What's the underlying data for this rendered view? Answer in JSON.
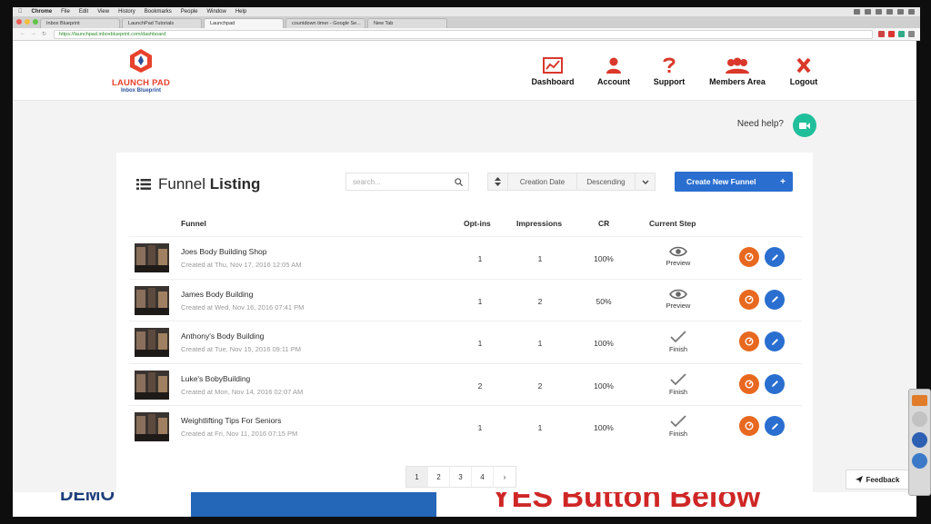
{
  "os_menu": {
    "items": [
      "Chrome",
      "File",
      "Edit",
      "View",
      "History",
      "Bookmarks",
      "People",
      "Window",
      "Help"
    ]
  },
  "browser": {
    "tabs": [
      {
        "label": "Inbox Blueprint",
        "active": false
      },
      {
        "label": "LaunchPad Tutorials",
        "active": false
      },
      {
        "label": "Launchpad",
        "active": true
      },
      {
        "label": "countdown timer - Google Se...",
        "active": false
      },
      {
        "label": "New Tab",
        "active": false
      }
    ],
    "url": "https://launchpad.inboxblueprint.com/dashboard"
  },
  "header": {
    "logo_line1": "LAUNCH PAD",
    "logo_line2": "Inbox Blueprint",
    "nav": [
      {
        "label": "Dashboard",
        "icon": "chart-icon"
      },
      {
        "label": "Account",
        "icon": "user-icon"
      },
      {
        "label": "Support",
        "icon": "question-icon"
      },
      {
        "label": "Members Area",
        "icon": "group-icon"
      },
      {
        "label": "Logout",
        "icon": "close-icon"
      }
    ]
  },
  "help": {
    "label": "Need help?"
  },
  "listing": {
    "title_light": "Funnel",
    "title_bold": "Listing",
    "search_placeholder": "search...",
    "sort_field": "Creation Date",
    "sort_order": "Descending",
    "create_label": "Create New Funnel",
    "columns": {
      "funnel": "Funnel",
      "optins": "Opt-ins",
      "impressions": "Impressions",
      "cr": "CR",
      "step": "Current Step"
    },
    "rows": [
      {
        "name": "Joes Body Building Shop",
        "created": "Created at Thu, Nov 17, 2016 12:05 AM",
        "optins": "1",
        "impressions": "1",
        "cr": "100%",
        "step": "Preview",
        "step_icon": "eye-icon"
      },
      {
        "name": "James Body Building",
        "created": "Created at Wed, Nov 16, 2016 07:41 PM",
        "optins": "1",
        "impressions": "2",
        "cr": "50%",
        "step": "Preview",
        "step_icon": "eye-icon"
      },
      {
        "name": "Anthony's Body Building",
        "created": "Created at Tue, Nov 15, 2016 09:11 PM",
        "optins": "1",
        "impressions": "1",
        "cr": "100%",
        "step": "Finish",
        "step_icon": "check-icon"
      },
      {
        "name": "Luke's BobyBuilding",
        "created": "Created at Mon, Nov 14, 2016 02:07 AM",
        "optins": "2",
        "impressions": "2",
        "cr": "100%",
        "step": "Finish",
        "step_icon": "check-icon"
      },
      {
        "name": "Weightlifting Tips For Seniors",
        "created": "Created at Fri, Nov 11, 2016 07:15 PM",
        "optins": "1",
        "impressions": "1",
        "cr": "100%",
        "step": "Finish",
        "step_icon": "check-icon"
      }
    ],
    "pages": [
      "1",
      "2",
      "3",
      "4",
      "›"
    ],
    "current_page": "1"
  },
  "feedback": {
    "label": "Feedback"
  },
  "background": {
    "demo_text": "DEMO",
    "red_text": "YES Button Below"
  },
  "colors": {
    "brand_red": "#e8412c",
    "primary_blue": "#2a6fd0",
    "action_orange": "#e8681f",
    "help_green": "#1fbf9b"
  }
}
